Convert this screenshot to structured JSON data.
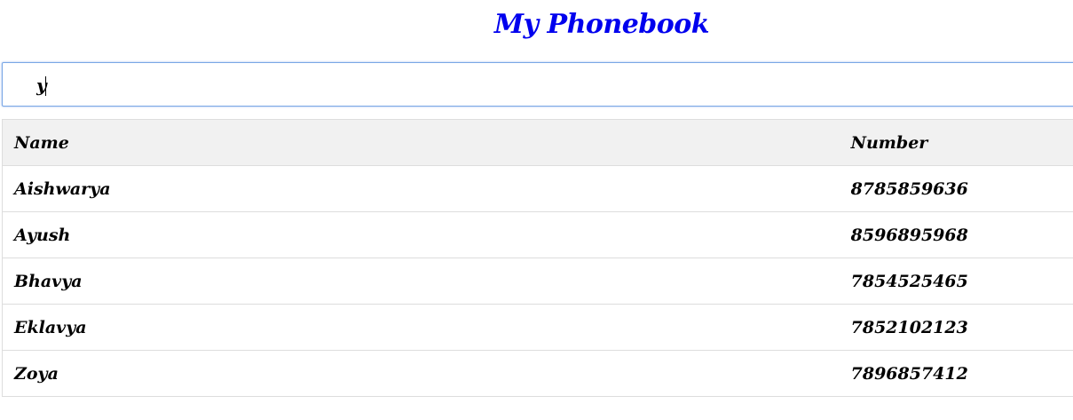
{
  "title": "My Phonebook",
  "search": {
    "value": "y",
    "placeholder": ""
  },
  "table": {
    "headers": {
      "name": "Name",
      "number": "Number"
    },
    "rows": [
      {
        "name": "Aishwarya",
        "number": "8785859636"
      },
      {
        "name": "Ayush",
        "number": "8596895968"
      },
      {
        "name": "Bhavya",
        "number": "7854525465"
      },
      {
        "name": "Eklavya",
        "number": "7852102123"
      },
      {
        "name": "Zoya",
        "number": "7896857412"
      }
    ]
  },
  "colors": {
    "title": "#0000ee",
    "search_border": "#7aa7e6",
    "header_bg": "#f1f1f1",
    "row_border": "#dddddd"
  }
}
